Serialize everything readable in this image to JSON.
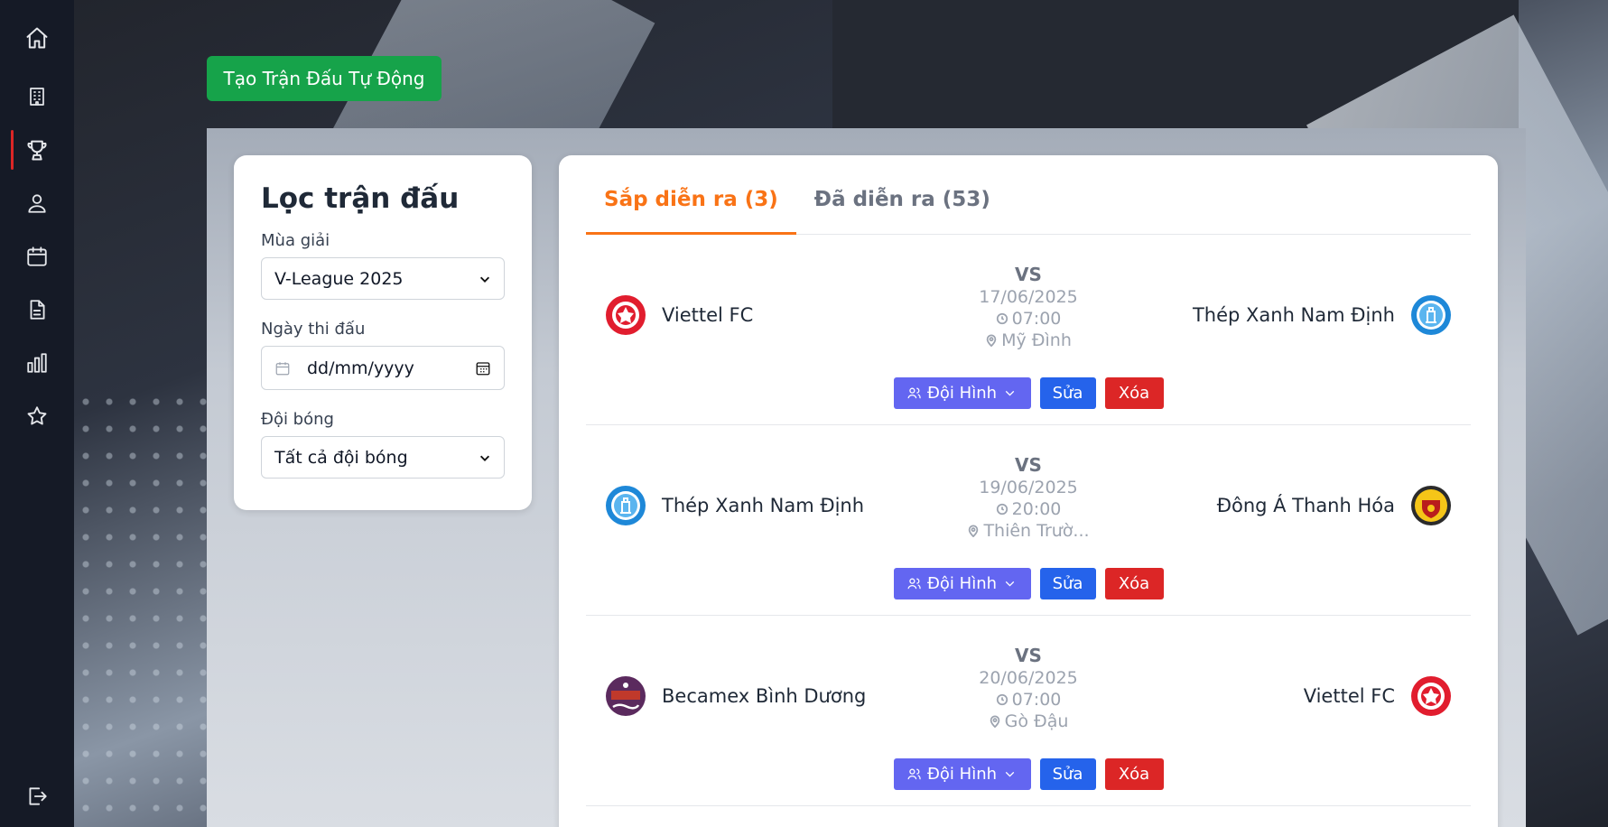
{
  "auto_create_label": "Tạo Trận Đấu Tự Động",
  "filter": {
    "title": "Lọc trận đấu",
    "season_label": "Mùa giải",
    "season_value": "V-League 2025",
    "date_label": "Ngày thi đấu",
    "date_placeholder": "dd/mm/yyyy",
    "team_label": "Đội bóng",
    "team_value": "Tất cả đội bóng"
  },
  "tabs": [
    {
      "label": "Sắp diễn ra (3)",
      "active": true
    },
    {
      "label": "Đã diễn ra (53)",
      "active": false
    }
  ],
  "matches": [
    {
      "home": "Viettel FC",
      "away": "Thép Xanh Nam Định",
      "vs": "VS",
      "date": "17/06/2025",
      "time": "07:00",
      "venue": "Mỹ Đình"
    },
    {
      "home": "Thép Xanh Nam Định",
      "away": "Đông Á Thanh Hóa",
      "vs": "VS",
      "date": "19/06/2025",
      "time": "20:00",
      "venue": "Thiên Trườ..."
    },
    {
      "home": "Becamex Bình Dương",
      "away": "Viettel FC",
      "vs": "VS",
      "date": "20/06/2025",
      "time": "07:00",
      "venue": "Gò Đậu"
    }
  ],
  "actions": {
    "lineup": "Đội Hình",
    "edit": "Sửa",
    "delete": "Xóa"
  },
  "sidebar_icons": [
    "home-icon",
    "building-icon",
    "trophy-icon",
    "user-icon",
    "calendar-icon",
    "document-icon",
    "chart-icon",
    "star-icon",
    "logout-icon"
  ],
  "colors": {
    "accent": "#f97316",
    "success": "#16a34a",
    "indigo": "#6366f1",
    "primary": "#2563eb",
    "danger": "#dc2626",
    "sidebar": "#151a26"
  }
}
